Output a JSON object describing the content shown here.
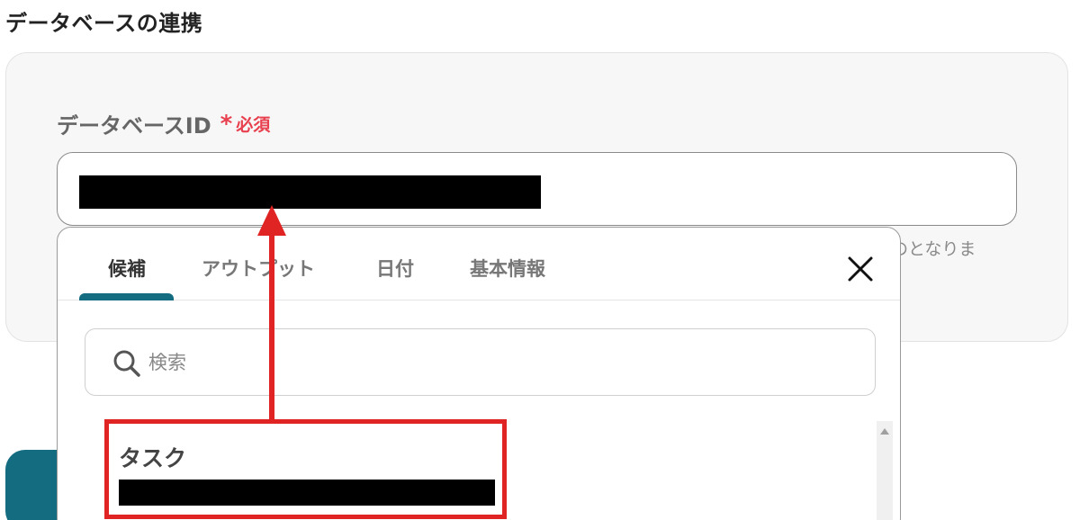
{
  "section": {
    "title": "データベースの連携"
  },
  "field": {
    "label": "データベースID",
    "asterisk": "*",
    "required": "必須",
    "help_text_fragment": "のとなりま"
  },
  "dropdown": {
    "tabs": [
      {
        "label": "候補",
        "active": true
      },
      {
        "label": "アウトプット",
        "active": false
      },
      {
        "label": "日付",
        "active": false
      },
      {
        "label": "基本情報",
        "active": false
      }
    ],
    "close_icon": "close-icon",
    "search": {
      "placeholder": "検索",
      "value": "",
      "icon": "search-icon"
    },
    "items": [
      {
        "title": "タスク"
      }
    ]
  },
  "colors": {
    "accent": "#146c80",
    "required": "#e8404f",
    "annotation": "#e02424"
  }
}
